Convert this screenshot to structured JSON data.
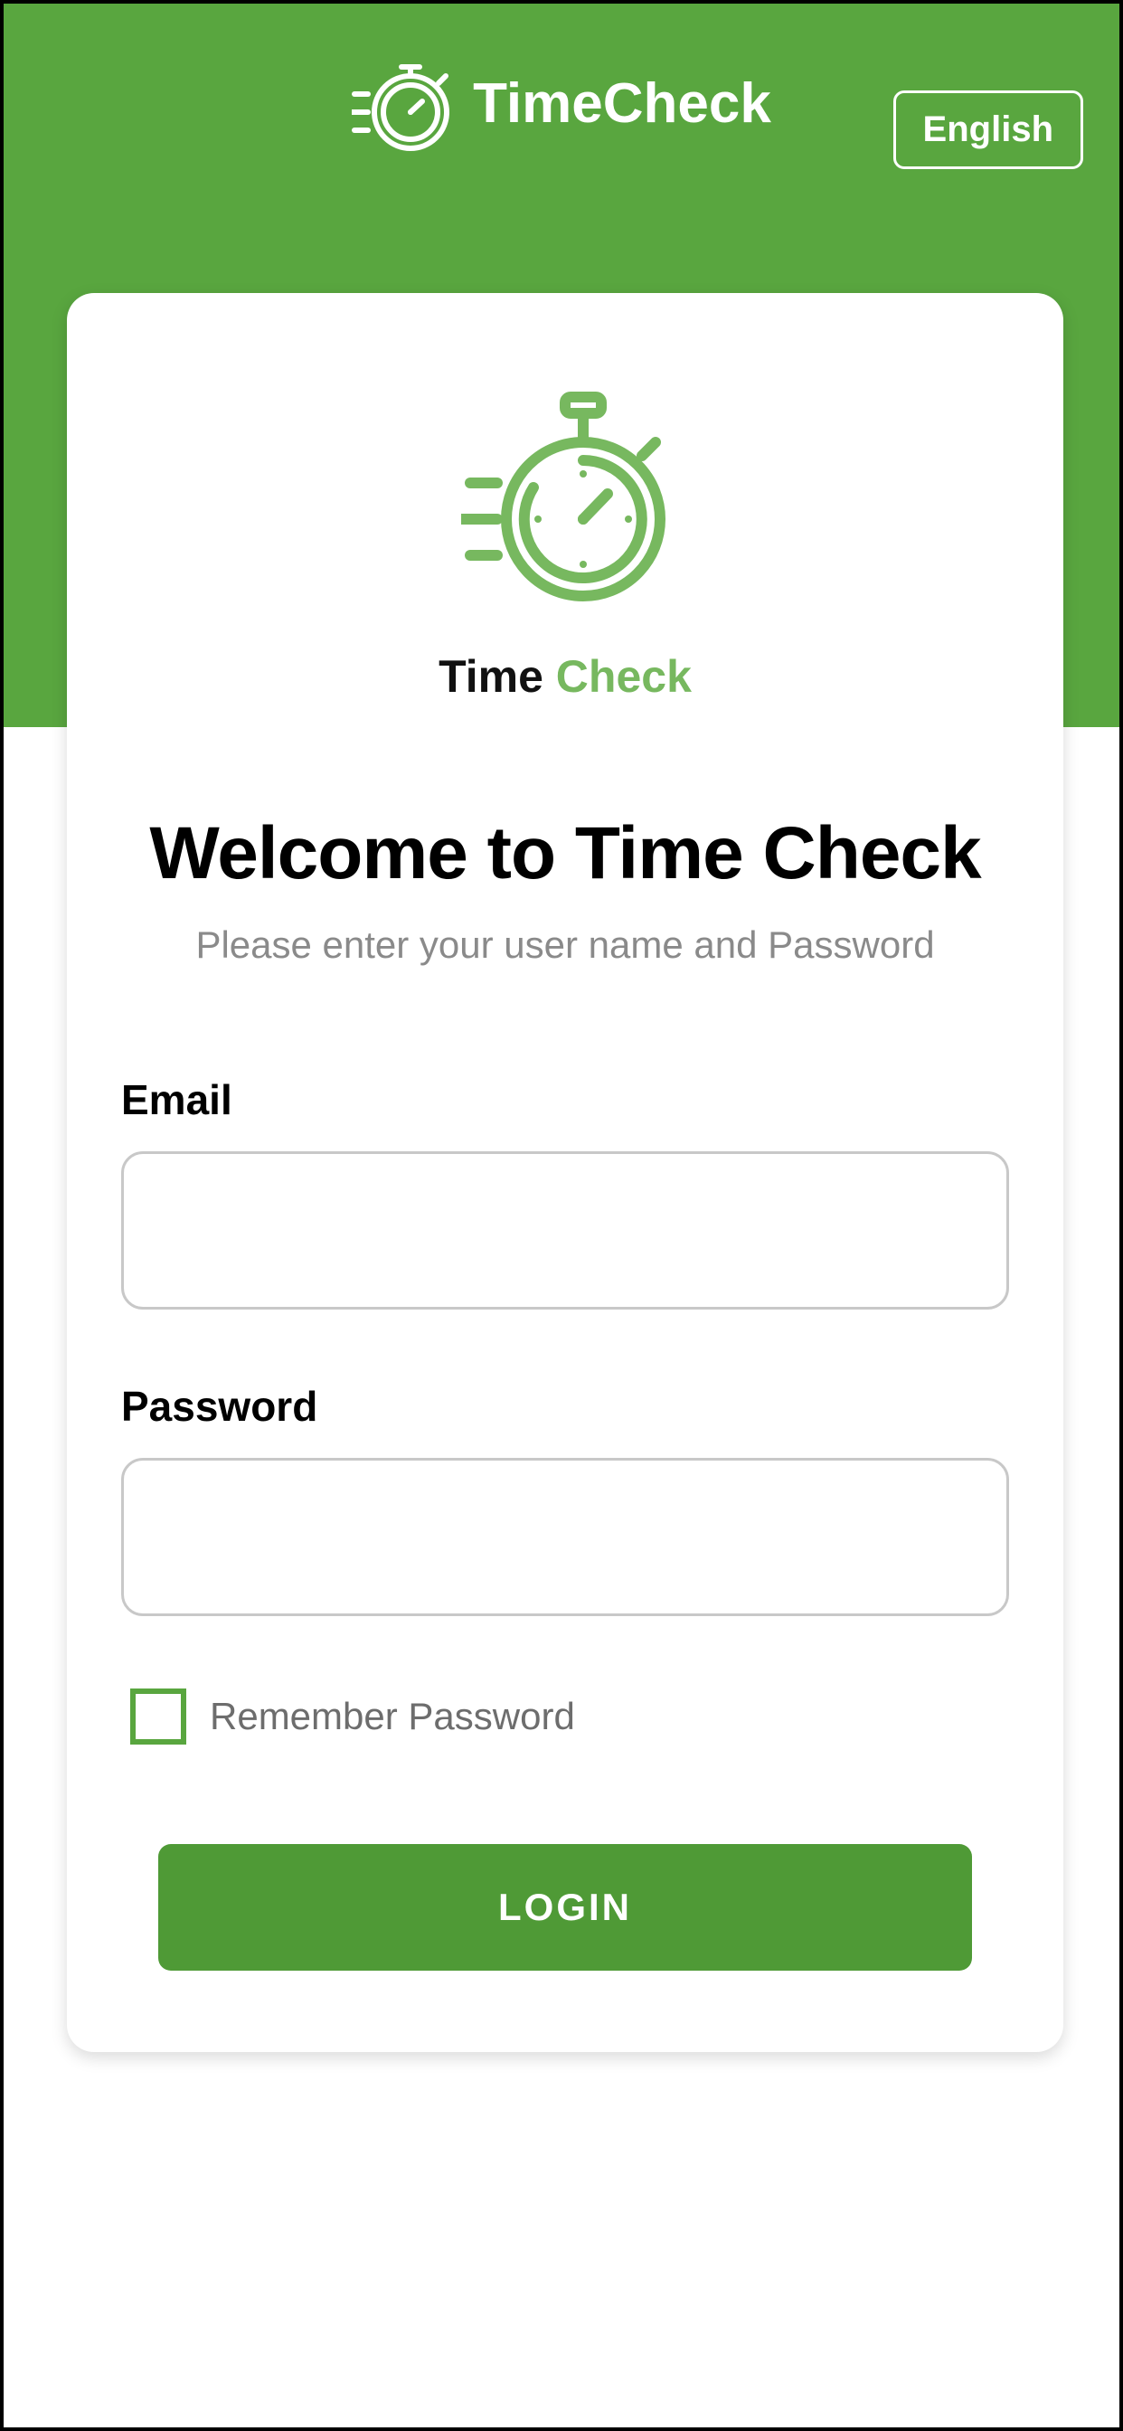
{
  "colors": {
    "brand_green": "#59a63f",
    "accent_green": "#77b85f",
    "button_green": "#4f9a36",
    "text_gray": "#8a8a8a"
  },
  "header": {
    "brand": "TimeCheck",
    "language_label": "English"
  },
  "card": {
    "brand_part1": "Time ",
    "brand_part2": "Check",
    "welcome_title": "Welcome to Time Check",
    "welcome_subtitle": "Please enter your user name and Password"
  },
  "form": {
    "email_label": "Email",
    "email_value": "",
    "password_label": "Password",
    "password_value": "",
    "remember_label": "Remember Password",
    "remember_checked": false,
    "login_label": "LOGIN"
  },
  "icons": {
    "header_logo": "stopwatch-icon",
    "card_logo": "stopwatch-icon"
  }
}
